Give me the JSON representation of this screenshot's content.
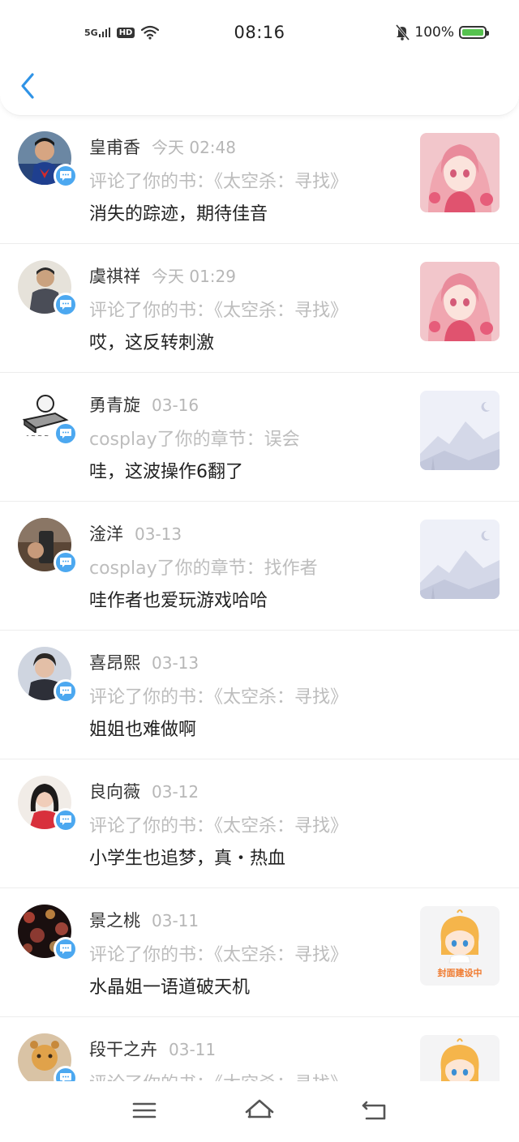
{
  "status_bar": {
    "network": "5G",
    "hd": "HD",
    "time": "08:16",
    "battery_label": "100%",
    "battery_level": 1.0,
    "icons": [
      "signal-icon",
      "wifi-icon",
      "mute-icon",
      "battery-icon"
    ]
  },
  "header": {
    "back_icon": "chevron-left-icon"
  },
  "colors": {
    "accent": "#4ca8f0",
    "back": "#2f93e6",
    "battery": "#56c24f"
  },
  "feed": [
    {
      "name": "皇甫香",
      "time": "今天 02:48",
      "action": "评论了你的书：《太空杀：寻找》",
      "message": "消失的踪迹，期待佳音",
      "thumb": "anime-girl"
    },
    {
      "name": "虞祺祥",
      "time": "今天 01:29",
      "action": "评论了你的书：《太空杀：寻找》",
      "message": "哎，这反转刺激",
      "thumb": "anime-girl"
    },
    {
      "name": "勇青旋",
      "time": "03-16",
      "action": "cosplay了你的章节：误会",
      "message": "哇，这波操作6翻了",
      "thumb": "placeholder"
    },
    {
      "name": "淦洋",
      "time": "03-13",
      "action": "cosplay了你的章节：找作者",
      "message": "哇作者也爱玩游戏哈哈",
      "thumb": "placeholder"
    },
    {
      "name": "喜昂熙",
      "time": "03-13",
      "action": "评论了你的书：《太空杀：寻找》",
      "message": "姐姐也难做啊",
      "thumb": "none"
    },
    {
      "name": "良向薇",
      "time": "03-12",
      "action": "评论了你的书：《太空杀：寻找》",
      "message": "小学生也追梦，真・热血",
      "thumb": "none"
    },
    {
      "name": "景之桃",
      "time": "03-11",
      "action": "评论了你的书：《太空杀：寻找》",
      "message": "水晶姐一语道破天机",
      "thumb": "cover-building",
      "thumb_label": "封面建设中"
    },
    {
      "name": "段干之卉",
      "time": "03-11",
      "action": "评论了你的书：《太空杀：寻找》",
      "message": "",
      "thumb": "cover-building-partial"
    }
  ],
  "navbar": {
    "icons": [
      "menu-icon",
      "home-icon",
      "back-icon"
    ]
  }
}
